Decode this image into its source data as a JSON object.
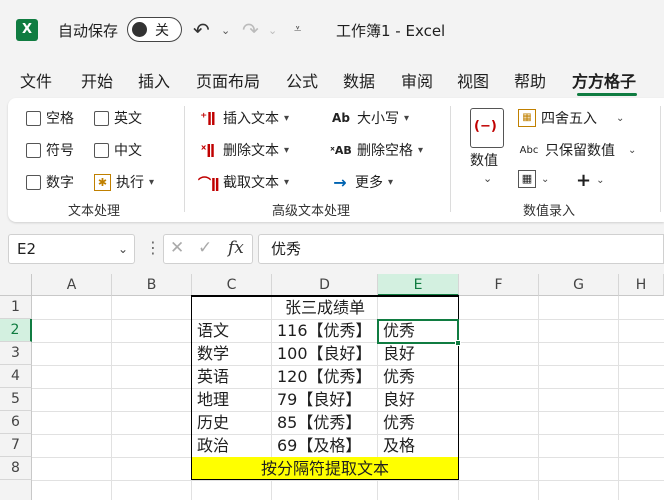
{
  "titlebar": {
    "autosave_label": "自动保存",
    "toggle_state": "关",
    "doc_title": "工作簿1  -  Excel"
  },
  "tabs": [
    "文件",
    "开始",
    "插入",
    "页面布局",
    "公式",
    "数据",
    "审阅",
    "视图",
    "帮助",
    "方方格子"
  ],
  "active_tab": "方方格子",
  "ribbon": {
    "text_group": {
      "label": "文本处理",
      "checkboxes": [
        "空格",
        "英文",
        "符号",
        "中文",
        "数字"
      ],
      "execute": "执行"
    },
    "advanced_group": {
      "label": "高级文本处理",
      "insert_text": "插入文本",
      "delete_text": "删除文本",
      "extract_text": "截取文本",
      "case": "大小写",
      "delete_spaces": "删除空格",
      "more": "更多"
    },
    "number_group": {
      "label": "数值录入",
      "value_button": "数值",
      "round": "四舍五入",
      "keep_value": "只保留数值"
    }
  },
  "formula_bar": {
    "name_box": "E2",
    "formula": "优秀",
    "fx": "fx"
  },
  "grid": {
    "columns": [
      "A",
      "B",
      "C",
      "D",
      "E",
      "F",
      "G",
      "H"
    ],
    "selected_column": "E",
    "rows": [
      "1",
      "2",
      "3",
      "4",
      "5",
      "6",
      "7",
      "8"
    ],
    "selected_row": "2",
    "title": "张三成绩单",
    "records": [
      {
        "subject": "语文",
        "score": "116【优秀】",
        "grade": "优秀"
      },
      {
        "subject": "数学",
        "score": "100【良好】",
        "grade": "良好"
      },
      {
        "subject": "英语",
        "score": "120【优秀】",
        "grade": "优秀"
      },
      {
        "subject": "地理",
        "score": "79【良好】",
        "grade": "良好"
      },
      {
        "subject": "历史",
        "score": "85【优秀】",
        "grade": "优秀"
      },
      {
        "subject": "政治",
        "score": "69【及格】",
        "grade": "及格"
      }
    ],
    "footer": "按分隔符提取文本"
  },
  "colors": {
    "accent": "#107c41",
    "highlight": "#ffff00"
  }
}
